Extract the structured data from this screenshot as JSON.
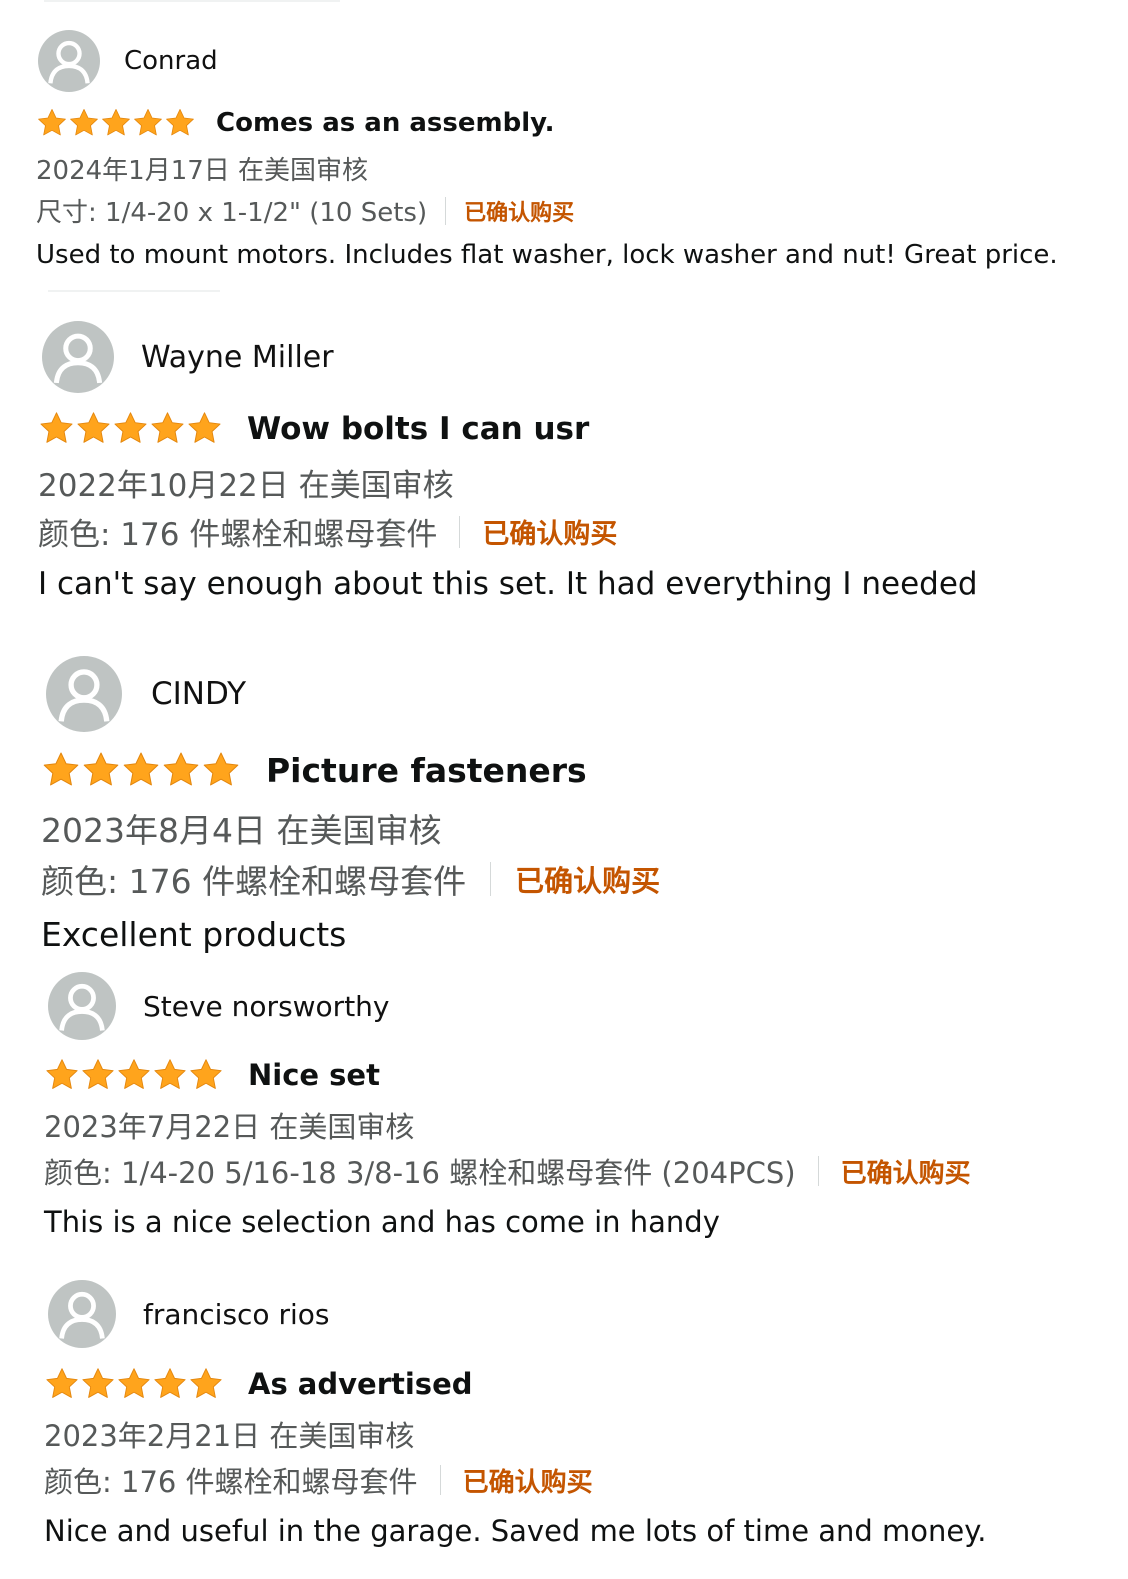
{
  "reviews": [
    {
      "name": "Conrad",
      "rating": 5,
      "title": "Comes as an assembly.",
      "date": "2024年1月17日 在美国审核",
      "variant": "尺寸: 1/4-20 x 1-1/2\" (10 Sets)",
      "verified": "已确认购买",
      "body": "Used to mount motors. Includes flat washer, lock washer and nut! Great price."
    },
    {
      "name": "Wayne Miller",
      "rating": 5,
      "title": "Wow bolts I can usr",
      "date": "2022年10月22日 在美国审核",
      "variant": "颜色: 176 件螺栓和螺母套件",
      "verified": "已确认购买",
      "body": "I can't say enough about this set. It had everything I needed"
    },
    {
      "name": "CINDY",
      "rating": 5,
      "title": "Picture fasteners",
      "date": "2023年8月4日 在美国审核",
      "variant": "颜色: 176 件螺栓和螺母套件",
      "verified": "已确认购买",
      "body": "Excellent products"
    },
    {
      "name": "Steve norsworthy",
      "rating": 5,
      "title": "Nice set",
      "date": "2023年7月22日 在美国审核",
      "variant": "颜色: 1/4-20 5/16-18 3/8-16 螺栓和螺母套件 (204PCS)",
      "verified": "已确认购买",
      "body": "This is a nice selection and has come in handy"
    },
    {
      "name": "francisco rios",
      "rating": 5,
      "title": "As advertised",
      "date": "2023年2月21日 在美国审核",
      "variant": "颜色: 176 件螺栓和螺母套件",
      "verified": "已确认购买",
      "body": "Nice and useful in the garage. Saved me lots of time and money."
    }
  ],
  "colors": {
    "star": "#ffa41c",
    "verified": "#c45500",
    "meta": "#565959",
    "text": "#0f1111",
    "avatar": "#bfc4c3"
  },
  "icons": {
    "avatar": "default-user-avatar-icon",
    "star": "star-filled-icon"
  }
}
